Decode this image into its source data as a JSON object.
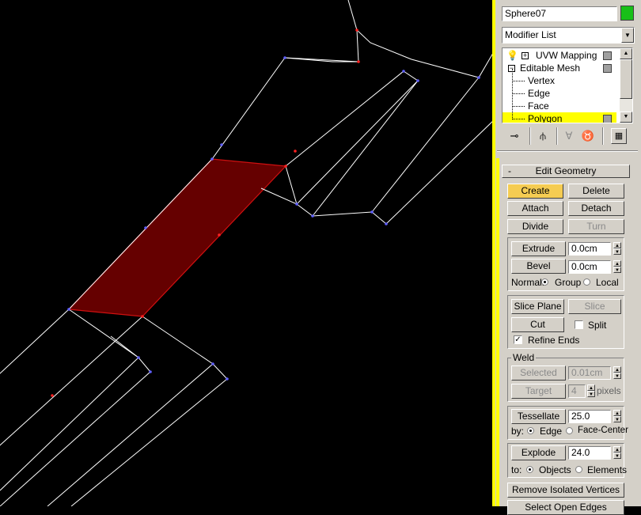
{
  "object_name": "Sphere07",
  "object_color": "#18c018",
  "modifier_list_label": "Modifier List",
  "modifier_stack": [
    {
      "label": "UVW Mapping",
      "prefix": "+"
    },
    {
      "label": "Editable Mesh",
      "prefix": "−"
    },
    {
      "label": "Vertex"
    },
    {
      "label": "Edge"
    },
    {
      "label": "Face"
    },
    {
      "label": "Polygon",
      "selected": true
    }
  ],
  "rollout": {
    "collapse_sign": "-",
    "title": "Edit Geometry"
  },
  "buttons": {
    "create": "Create",
    "delete": "Delete",
    "attach": "Attach",
    "detach": "Detach",
    "divide": "Divide",
    "turn": "Turn",
    "extrude": "Extrude",
    "bevel": "Bevel",
    "slice_plane": "Slice Plane",
    "slice": "Slice",
    "cut": "Cut",
    "selected": "Selected",
    "target": "Target",
    "tessellate": "Tessellate",
    "explode": "Explode",
    "remove_isolated": "Remove Isolated Vertices",
    "select_open_edges": "Select Open Edges"
  },
  "fields": {
    "extrude_value": "0.0cm",
    "bevel_value": "0.0cm",
    "weld_selected_value": "0.01cm",
    "weld_target_value": "4",
    "tessellate_value": "25.0",
    "explode_value": "24.0"
  },
  "labels": {
    "normal": "Normal:",
    "group": "Group",
    "local": "Local",
    "split": "Split",
    "refine_ends": "Refine Ends",
    "weld": "Weld",
    "pixels": "pixels",
    "by": "by:",
    "edge": "Edge",
    "face_center": "Face-Center",
    "to": "to:",
    "objects": "Objects",
    "elements": "Elements"
  },
  "states": {
    "normal": "Group",
    "split": false,
    "refine_ends": true,
    "tessellate_by": "Edge",
    "explode_to": "Objects"
  },
  "icons": [
    "lightbulb-icon",
    "pin-stack-icon",
    "modifier-active-icon",
    "show-end-result-icon",
    "make-unique-icon",
    "remove-modifier-icon",
    "configure-modifier-sets-icon"
  ],
  "colors": {
    "selected_polygon": "#650000",
    "selection_highlight": "#ffff00",
    "create_button": "#f5cc52",
    "selection_frame": "#ffff00"
  }
}
